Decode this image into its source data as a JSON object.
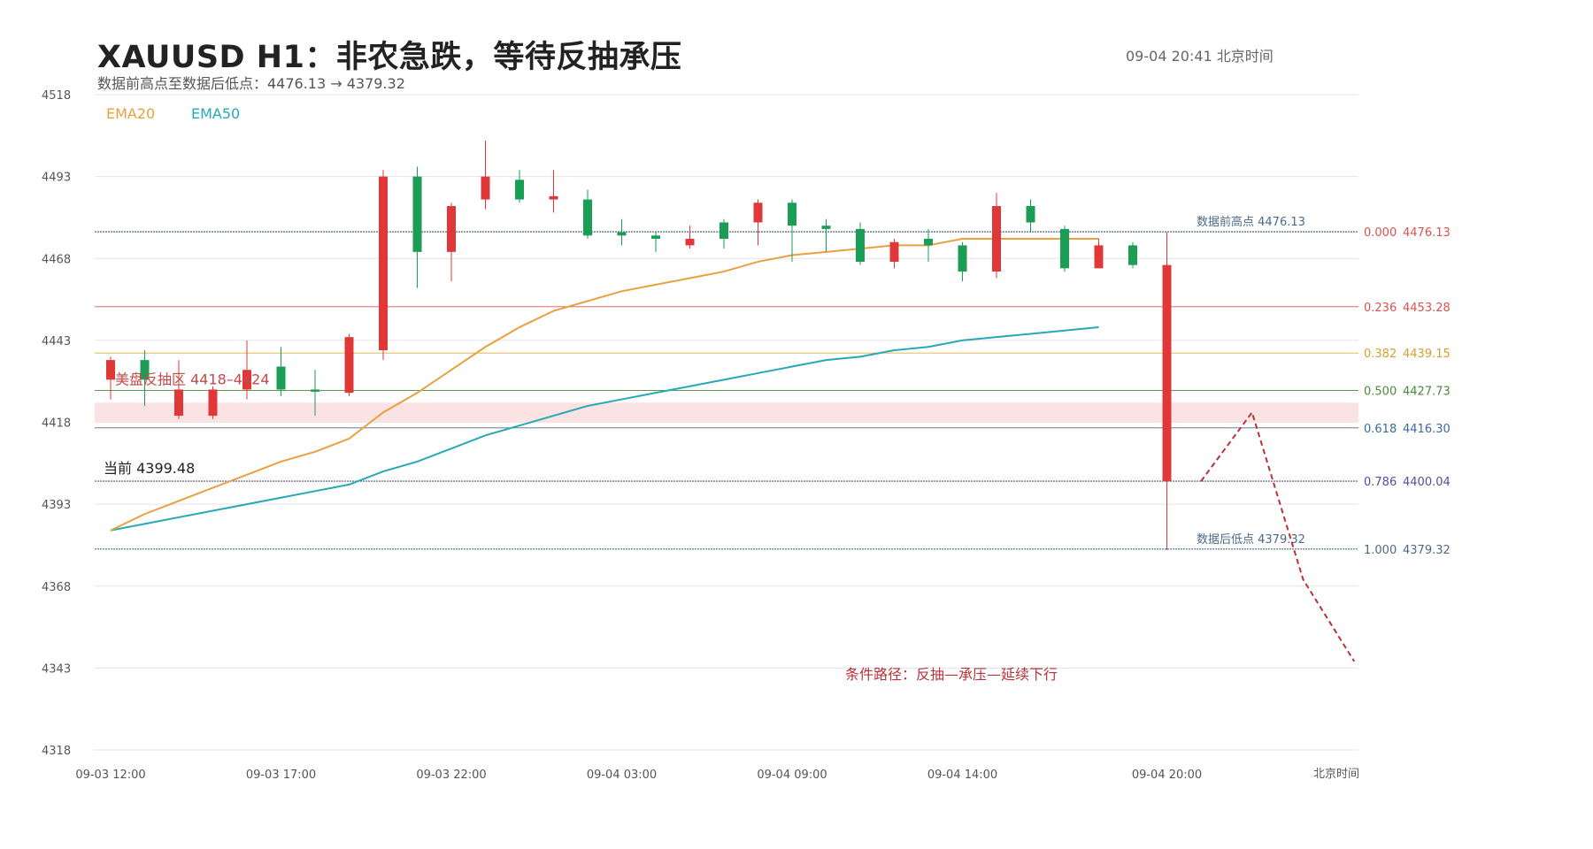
{
  "header": {
    "title": "XAUUSD  H1：非农急跌，等待反抽承压",
    "subtitle": "数据前高点至数据后低点：4476.13 → 4379.32",
    "timestamp": "09-04  20:41 北京时间"
  },
  "chart_data": {
    "type": "candlestick",
    "y_ticks": [
      "4518",
      "4493",
      "4468",
      "4443",
      "4418",
      "4393",
      "4368",
      "4343",
      "4318"
    ],
    "ylim": [
      4318,
      4518
    ],
    "x_ticks": [
      {
        "label": "09-03 12:00",
        "index": 0
      },
      {
        "label": "09-03 17:00",
        "index": 5
      },
      {
        "label": "09-03 22:00",
        "index": 10
      },
      {
        "label": "09-04 03:00",
        "index": 15
      },
      {
        "label": "09-04 09:00",
        "index": 20
      },
      {
        "label": "09-04 14:00",
        "index": 25
      },
      {
        "label": "09-04 20:00",
        "index": 31
      }
    ],
    "x_axis_label": "北京时间",
    "legend": [
      {
        "name": "EMA20",
        "color": "#e8a040"
      },
      {
        "name": "EMA50",
        "color": "#27a9b5"
      }
    ],
    "candles": [
      {
        "o": 4437,
        "h": 4438,
        "l": 4425,
        "c": 4431
      },
      {
        "o": 4431,
        "h": 4440,
        "l": 4423,
        "c": 4437
      },
      {
        "o": 4428,
        "h": 4437,
        "l": 4419,
        "c": 4420
      },
      {
        "o": 4428,
        "h": 4429,
        "l": 4419,
        "c": 4420
      },
      {
        "o": 4434,
        "h": 4443,
        "l": 4425,
        "c": 4428
      },
      {
        "o": 4428,
        "h": 4441,
        "l": 4426,
        "c": 4435
      },
      {
        "o": 4428,
        "h": 4434,
        "l": 4420,
        "c": 4428
      },
      {
        "o": 4444,
        "h": 4445,
        "l": 4426,
        "c": 4427
      },
      {
        "o": 4493,
        "h": 4495,
        "l": 4437,
        "c": 4440
      },
      {
        "o": 4470,
        "h": 4496,
        "l": 4459,
        "c": 4493
      },
      {
        "o": 4484,
        "h": 4485,
        "l": 4461,
        "c": 4470
      },
      {
        "o": 4493,
        "h": 4504,
        "l": 4483,
        "c": 4486
      },
      {
        "o": 4486,
        "h": 4495,
        "l": 4485,
        "c": 4492
      },
      {
        "o": 4487,
        "h": 4495,
        "l": 4482,
        "c": 4486
      },
      {
        "o": 4475,
        "h": 4489,
        "l": 4474,
        "c": 4486
      },
      {
        "o": 4475,
        "h": 4480,
        "l": 4472,
        "c": 4476
      },
      {
        "o": 4474,
        "h": 4476,
        "l": 4470,
        "c": 4475
      },
      {
        "o": 4474,
        "h": 4478,
        "l": 4471,
        "c": 4472
      },
      {
        "o": 4474,
        "h": 4480,
        "l": 4471,
        "c": 4479
      },
      {
        "o": 4485,
        "h": 4486,
        "l": 4472,
        "c": 4479
      },
      {
        "o": 4478,
        "h": 4486,
        "l": 4467,
        "c": 4485
      },
      {
        "o": 4477,
        "h": 4480,
        "l": 4470,
        "c": 4478
      },
      {
        "o": 4467,
        "h": 4479,
        "l": 4466,
        "c": 4477
      },
      {
        "o": 4473,
        "h": 4474,
        "l": 4465,
        "c": 4467
      },
      {
        "o": 4472,
        "h": 4477,
        "l": 4467,
        "c": 4474
      },
      {
        "o": 4464,
        "h": 4473,
        "l": 4461,
        "c": 4472
      },
      {
        "o": 4484,
        "h": 4488,
        "l": 4462,
        "c": 4464
      },
      {
        "o": 4479,
        "h": 4486,
        "l": 4476,
        "c": 4484
      },
      {
        "o": 4465,
        "h": 4478,
        "l": 4464,
        "c": 4477
      },
      {
        "o": 4472,
        "h": 4474,
        "l": 4465,
        "c": 4465
      },
      {
        "o": 4466,
        "h": 4473,
        "l": 4465,
        "c": 4472
      },
      {
        "o": 4466,
        "h": 4476,
        "l": 4379,
        "c": 4400
      }
    ],
    "ema20": [
      4385,
      4390,
      4394,
      4398,
      4402,
      4406,
      4409,
      4413,
      4421,
      4427,
      4434,
      4441,
      4447,
      4452,
      4455,
      4458,
      4460,
      4462,
      4464,
      4467,
      4469,
      4470,
      4471,
      4472,
      4472,
      4474,
      4474,
      4474,
      4474,
      4474
    ],
    "ema50": [
      4385,
      4387,
      4389,
      4391,
      4393,
      4395,
      4397,
      4399,
      4403,
      4406,
      4410,
      4414,
      4417,
      4420,
      4423,
      4425,
      4427,
      4429,
      4431,
      4433,
      4435,
      4437,
      4438,
      4440,
      4441,
      4443,
      4444,
      4445,
      4446,
      4447
    ],
    "fib_levels": [
      {
        "ratio": "0.000",
        "price": "4476.13",
        "value": 4476.13,
        "color": "#d9534f",
        "line_color": "#4b6a8a"
      },
      {
        "ratio": "0.236",
        "price": "4453.28",
        "value": 4453.28,
        "color": "#d9534f",
        "line_color": "#d9534f"
      },
      {
        "ratio": "0.382",
        "price": "4439.15",
        "value": 4439.15,
        "color": "#d4a030",
        "line_color": "#e0b040"
      },
      {
        "ratio": "0.500",
        "price": "4427.73",
        "value": 4427.73,
        "color": "#4a8a3a",
        "line_color": "#4a8a3a"
      },
      {
        "ratio": "0.618",
        "price": "4416.30",
        "value": 4416.3,
        "color": "#3a6aa0",
        "line_color": "#4b6a8a"
      },
      {
        "ratio": "0.786",
        "price": "4400.04",
        "value": 4400.04,
        "color": "#5050a0",
        "line_color": "#5050a0"
      },
      {
        "ratio": "1.000",
        "price": "4379.32",
        "value": 4379.32,
        "color": "#4b6a8a",
        "line_color": "#4b6a8a"
      }
    ],
    "annotations": {
      "high_label": "数据前高点 4476.13",
      "low_label": "数据后低点 4379.32",
      "current_label": "当前 4399.48",
      "current_value": 4399.48,
      "zone_label": "美盘反抽区  4418–4424",
      "zone": [
        4418,
        4424
      ],
      "path_label": "条件路径：反抽—承压—延续下行",
      "path_points": [
        {
          "i": 32,
          "v": 4400
        },
        {
          "i": 33.5,
          "v": 4421
        },
        {
          "i": 35,
          "v": 4370
        },
        {
          "i": 36.5,
          "v": 4345
        }
      ]
    },
    "colors": {
      "up": "#1a9e55",
      "down": "#e03838",
      "grid": "#e4e4e4",
      "zone": "#fbe3e3",
      "path": "#b8323a"
    }
  }
}
